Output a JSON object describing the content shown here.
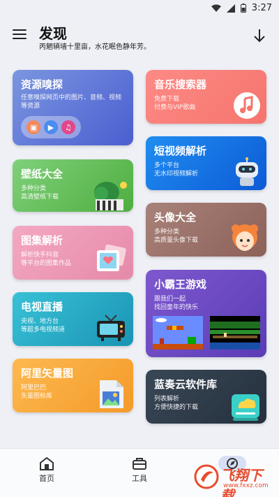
{
  "status": {
    "time": "3:27"
  },
  "appbar": {
    "title": "发现",
    "subtitle": "丙魍辆墙十里亩，水花眠色静年芳。"
  },
  "cards_left": [
    {
      "title": "资源嗅探",
      "desc": "任意嗅探网页中的图片、音频、视频等资源"
    },
    {
      "title": "壁纸大全",
      "desc": "多种分类\n高清壁纸下载"
    },
    {
      "title": "图集解析",
      "desc": "解析快手抖音\n等平台的图集作品"
    },
    {
      "title": "电视直播",
      "desc": "央视、地方台\n等超多电视频道"
    },
    {
      "title": "阿里矢量图",
      "desc": "阿里巴巴\n矢量图标库"
    }
  ],
  "cards_right": [
    {
      "title": "音乐搜索器",
      "desc": "免费下载\n付费与VIP歌曲"
    },
    {
      "title": "短视频解析",
      "desc": "多个平台\n无水印视频解析"
    },
    {
      "title": "头像大全",
      "desc": "多种分类\n高质量头像下载"
    },
    {
      "title": "小霸王游戏",
      "desc": "跟我们一起\n找回童年的快乐"
    },
    {
      "title": "蓝奏云软件库",
      "desc": "列表解析\n方便快捷的下载"
    }
  ],
  "nav": [
    {
      "label": "首页"
    },
    {
      "label": "工具"
    }
  ],
  "watermark": {
    "text": "飞翔下载",
    "sub": "www.fxxz.com"
  }
}
